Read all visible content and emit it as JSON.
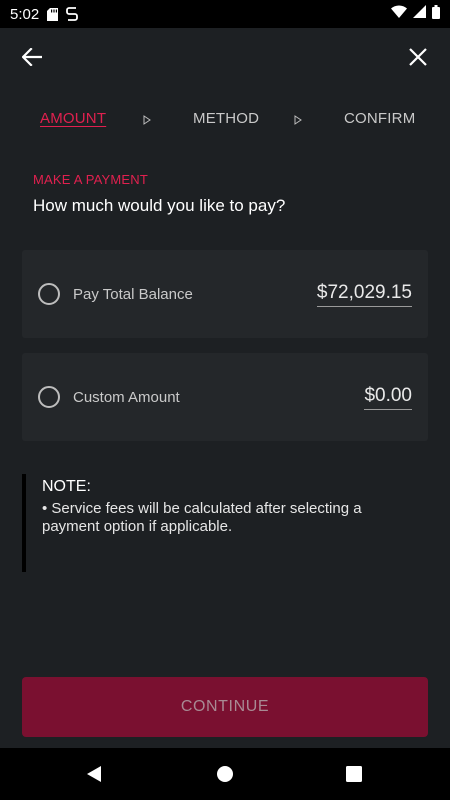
{
  "status_bar": {
    "time": "5:02",
    "icons_left": [
      "sd-card-icon",
      "sync-icon"
    ],
    "icons_right": [
      "wifi-icon",
      "signal-icon",
      "battery-icon"
    ]
  },
  "app_bar": {
    "back_icon": "back-arrow-icon",
    "close_icon": "close-icon"
  },
  "steps": [
    {
      "label": "AMOUNT",
      "active": true
    },
    {
      "label": "METHOD",
      "active": false
    },
    {
      "label": "CONFIRM",
      "active": false
    }
  ],
  "payment": {
    "section_label": "MAKE A PAYMENT",
    "title": "How much would you like to pay?",
    "options": [
      {
        "label": "Pay Total Balance",
        "value": "$72,029.15",
        "selected": false
      },
      {
        "label": "Custom Amount",
        "value": "$0.00",
        "selected": false
      }
    ]
  },
  "note": {
    "title": "NOTE:",
    "text": "• Service fees will be calculated after selecting a payment option if applicable."
  },
  "continue_label": "CONTINUE",
  "colors": {
    "accent": "#e0204f",
    "background": "#1d2023",
    "card": "#24272a",
    "button": "#7a1030"
  }
}
